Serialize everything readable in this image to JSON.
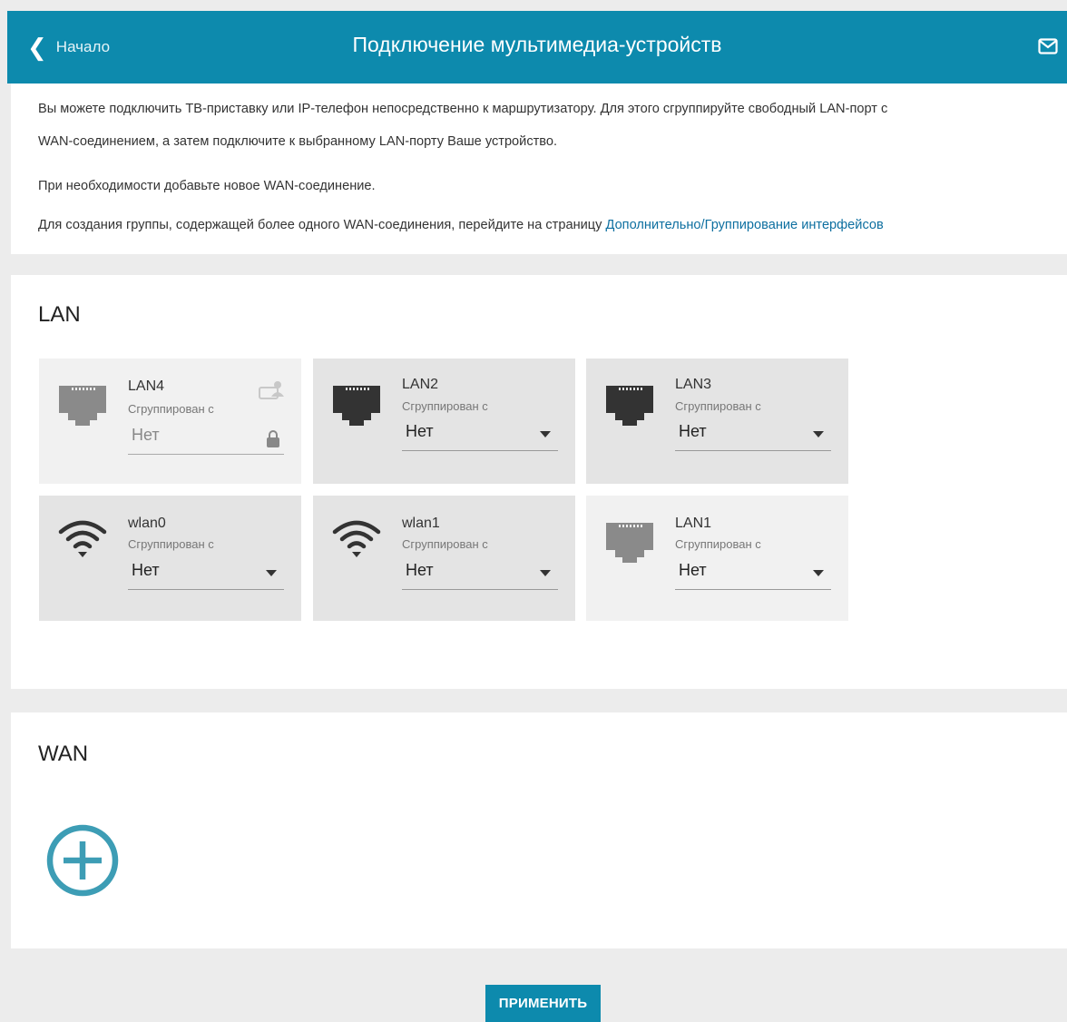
{
  "header": {
    "back_label": "Начало",
    "title": "Подключение мультимедиа-устройств"
  },
  "info": {
    "line1": "Вы можете подключить ТВ-приставку или IP-телефон непосредственно к маршрутизатору. Для этого сгруппируйте свободный LAN-порт с",
    "line2": "WAN-соединением, а затем подключите к выбранному LAN-порту Ваше устройство.",
    "line3": "При необходимости добавьте новое WAN-соединение.",
    "line4_prefix": "Для создания группы, содержащей более одного WAN-соединения, перейдите на страницу ",
    "line4_link": "Дополнительно/Группирование интерфейсов"
  },
  "lan": {
    "title": "LAN",
    "ports": [
      {
        "name": "LAN4",
        "sub": "Сгруппирован с",
        "value": "Нет",
        "icon": "ethernet-port-icon",
        "locked": true
      },
      {
        "name": "LAN2",
        "sub": "Сгруппирован с",
        "value": "Нет",
        "icon": "ethernet-port-icon",
        "locked": false
      },
      {
        "name": "LAN3",
        "sub": "Сгруппирован с",
        "value": "Нет",
        "icon": "ethernet-port-icon",
        "locked": false
      },
      {
        "name": "wlan0",
        "sub": "Сгруппирован с",
        "value": "Нет",
        "icon": "wifi-icon",
        "locked": false
      },
      {
        "name": "wlan1",
        "sub": "Сгруппирован с",
        "value": "Нет",
        "icon": "wifi-icon",
        "locked": false
      },
      {
        "name": "LAN1",
        "sub": "Сгруппирован с",
        "value": "Нет",
        "icon": "ethernet-port-icon",
        "locked": false
      }
    ]
  },
  "wan": {
    "title": "WAN"
  },
  "apply_label": "ПРИМЕНИТЬ",
  "colors": {
    "accent": "#0d8aad",
    "add_icon": "#3d9db5",
    "link": "#0d6fa0"
  }
}
